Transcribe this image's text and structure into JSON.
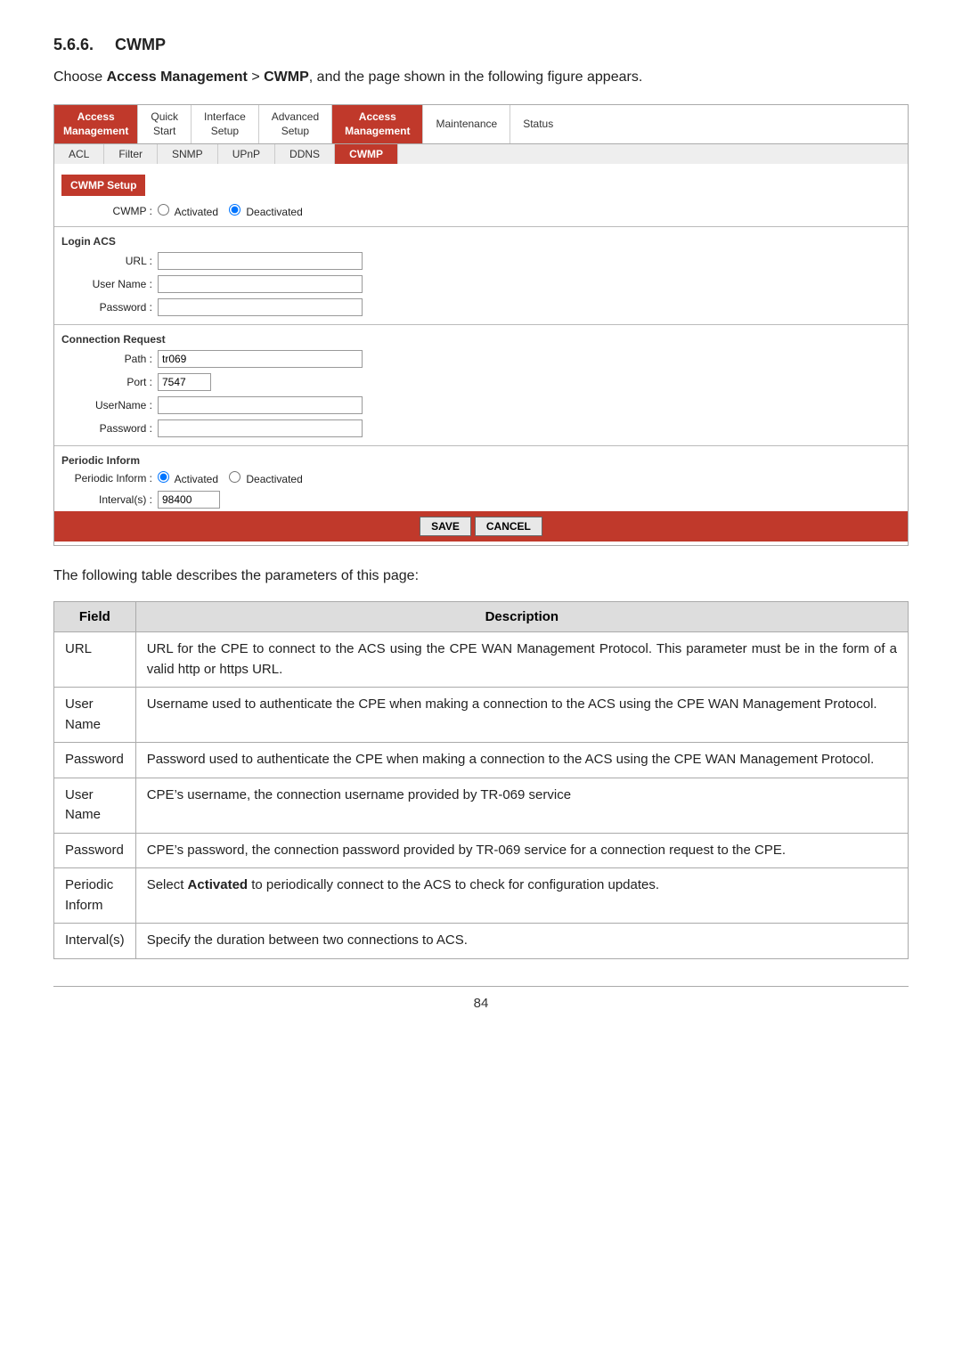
{
  "section": {
    "number": "5.6.6.",
    "title": "CWMP",
    "intro": "Choose ",
    "intro_bold1": "Access Management",
    "intro_mid": " > ",
    "intro_bold2": "CWMP",
    "intro_end": ", and the page shown in the following figure appears."
  },
  "navbar": {
    "access_mgmt_label": "Access\nManagement",
    "items": [
      {
        "label": "Quick\nStart",
        "active": false
      },
      {
        "label": "Interface\nSetup",
        "active": false
      },
      {
        "label": "Advanced\nSetup",
        "active": false
      },
      {
        "label": "Access\nManagement",
        "active": true
      },
      {
        "label": "Maintenance",
        "active": false
      },
      {
        "label": "Status",
        "active": false
      }
    ],
    "sub_items": [
      {
        "label": "ACL",
        "active": false
      },
      {
        "label": "Filter",
        "active": false
      },
      {
        "label": "SNMP",
        "active": false
      },
      {
        "label": "UPnP",
        "active": false
      },
      {
        "label": "DDNS",
        "active": false
      },
      {
        "label": "CWMP",
        "active": true
      }
    ]
  },
  "cwmp_form": {
    "setup_header": "CWMP Setup",
    "cwmp_label": "CWMP :",
    "cwmp_options": [
      "Activated",
      "Deactivated"
    ],
    "cwmp_selected": "Deactivated",
    "login_acs_label": "Login ACS",
    "url_label": "URL :",
    "username_label": "User Name :",
    "password_label": "Password :",
    "connection_request_label": "Connection Request",
    "path_label": "Path :",
    "path_value": "tr069",
    "port_label": "Port :",
    "port_value": "7547",
    "conn_username_label": "UserName :",
    "conn_password_label": "Password :",
    "periodic_inform_label": "Periodic Inform",
    "periodic_inform_label2": "Periodic Inform :",
    "periodic_options": [
      "Activated",
      "Deactivated"
    ],
    "periodic_selected": "Activated",
    "interval_label": "Interval(s) :",
    "interval_value": "98400",
    "save_btn": "SAVE",
    "cancel_btn": "CANCEL"
  },
  "table_intro": "The following table describes the parameters of this page:",
  "table": {
    "headers": [
      "Field",
      "Description"
    ],
    "rows": [
      {
        "field": "URL",
        "description": "URL for the CPE to connect to the ACS using the CPE WAN Management Protocol. This parameter must be in the form of a valid http or https URL."
      },
      {
        "field": "User\nName",
        "description": "Username used to authenticate the CPE when making a connection to the ACS using the CPE WAN Management Protocol."
      },
      {
        "field": "Password",
        "description": "Password used to authenticate the CPE when making a connection to the ACS using the CPE WAN Management Protocol."
      },
      {
        "field": "User\nName",
        "description": "CPE’s username, the connection username provided by TR-069 service"
      },
      {
        "field": "Password",
        "description": "CPE’s password, the connection password provided by TR-069 service for a connection request to the CPE."
      },
      {
        "field": "Periodic\nInform",
        "description_pre": "Select ",
        "description_bold": "Activated",
        "description_post": " to periodically connect to the ACS to check for configuration updates."
      },
      {
        "field": "Interval(s)",
        "description": "Specify the duration between two connections to ACS."
      }
    ]
  },
  "page_number": "84"
}
